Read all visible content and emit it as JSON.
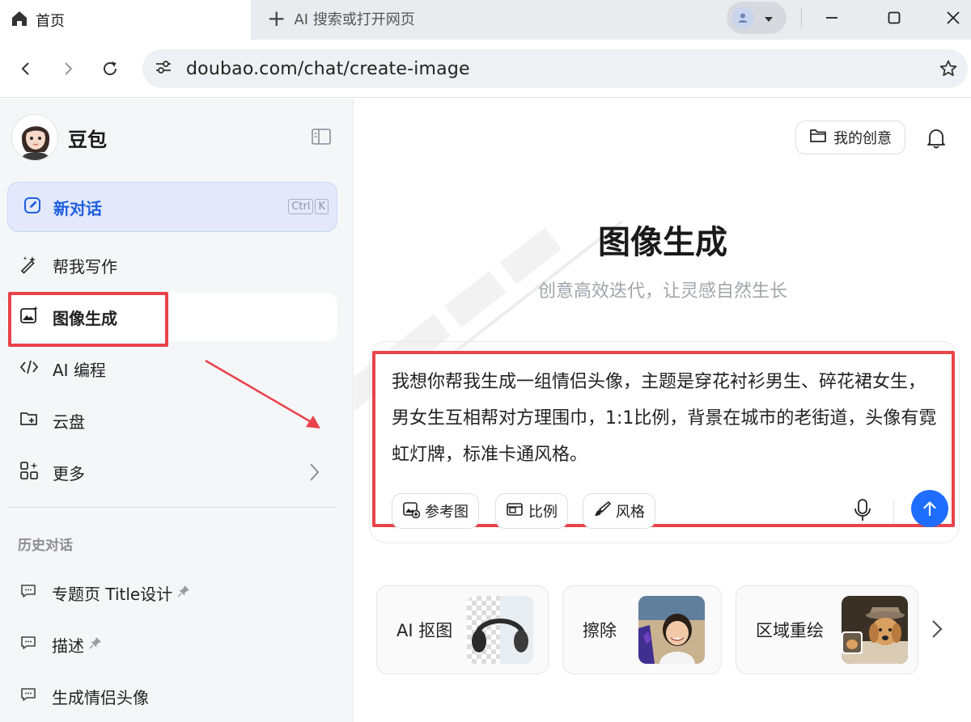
{
  "browser": {
    "tab_title": "首页",
    "new_tab_label": "AI 搜索或打开网页",
    "url": "doubao.com/chat/create-image"
  },
  "sidebar": {
    "brand_name": "豆包",
    "new_chat": {
      "label": "新对话",
      "shortcut": [
        "Ctrl",
        "K"
      ]
    },
    "items": [
      {
        "label": "帮我写作",
        "icon": "pen-sparkle-icon"
      },
      {
        "label": "图像生成",
        "icon": "image-sparkle-icon",
        "active": true
      },
      {
        "label": "AI 编程",
        "icon": "code-icon"
      },
      {
        "label": "云盘",
        "icon": "cloud-folder-icon"
      },
      {
        "label": "更多",
        "icon": "grid-icon"
      }
    ],
    "history_title": "历史对话",
    "history": [
      {
        "label": "专题页 Title设计",
        "pinned": true
      },
      {
        "label": "描述",
        "pinned": true
      },
      {
        "label": "生成情侣头像",
        "pinned": false
      }
    ]
  },
  "main": {
    "my_creative": "我的创意",
    "title": "图像生成",
    "subtitle": "创意高效迭代，让灵感自然生长",
    "prompt": "我想你帮我生成一组情侣头像，主题是穿花衬衫男生、碎花裙女生，男女生互相帮对方理围巾，1:1比例，背景在城市的老街道，头像有霓虹灯牌，标准卡通风格。",
    "tools": {
      "reference": "参考图",
      "ratio": "比例",
      "style": "风格"
    },
    "features": [
      {
        "label": "AI 抠图"
      },
      {
        "label": "擦除"
      },
      {
        "label": "区域重绘"
      }
    ]
  },
  "colors": {
    "accent": "#1f6dff",
    "highlight": "#e9434a",
    "sidebar_bg": "#f5f6f8",
    "new_chat_bg": "#e3e9fb"
  }
}
